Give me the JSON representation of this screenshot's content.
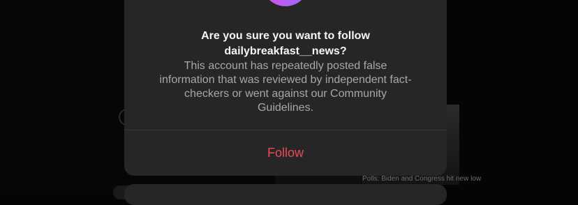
{
  "dialog": {
    "title_line1": "Are you sure you want to follow",
    "title_line2": "dailybreakfast__news?",
    "body_line1": "This account has repeatedly posted false",
    "body_line2": "information that was reviewed by independent fact-",
    "body_line3": "checkers or went against our Community",
    "body_line4": "Guidelines.",
    "follow_label": "Follow",
    "follow_color": "#ed4956",
    "avatar_gradient": [
      "#e24aa7",
      "#c15cf0",
      "#8f6bff"
    ]
  },
  "background": {
    "caption": "Polls: Biden and Congress hit new low"
  }
}
